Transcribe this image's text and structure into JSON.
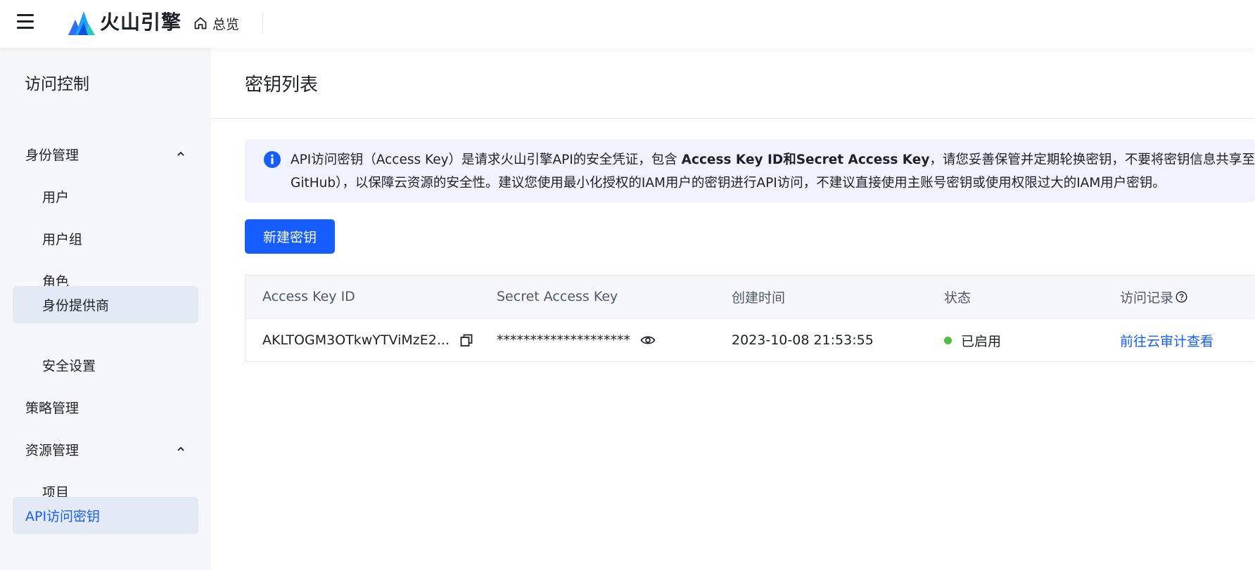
{
  "header": {
    "brand": "火山引擎",
    "home_label": "总览"
  },
  "sidebar": {
    "title": "访问控制",
    "items": [
      {
        "label": "身份管理"
      },
      {
        "label": "用户"
      },
      {
        "label": "用户组"
      },
      {
        "label": "角色"
      },
      {
        "label": "身份提供商"
      },
      {
        "label": "安全设置"
      },
      {
        "label": "策略管理"
      },
      {
        "label": "资源管理"
      },
      {
        "label": "项目"
      },
      {
        "label": "API访问密钥"
      }
    ]
  },
  "main": {
    "title": "密钥列表",
    "alert": {
      "text_part1": "API访问密钥（Access Key）是请求火山引擎API的安全凭证，包含 ",
      "text_bold": "Access Key ID和Secret Access Key",
      "text_part2": "，请您妥善保管并定期轮换密钥，不要将密钥信息共享至",
      "line2": "GitHub），以保障云资源的安全性。建议您使用最小化授权的IAM用户的密钥进行API访问，不建议直接使用主账号密钥或使用权限过大的IAM用户密钥。"
    },
    "new_key_button": "新建密钥",
    "table": {
      "columns": [
        "Access Key ID",
        "Secret Access Key",
        "创建时间",
        "状态",
        "访问记录"
      ],
      "rows": [
        {
          "access_key_id": "AKLTOGM3OTkwYTViMzE2...",
          "secret": "********************",
          "created": "2023-10-08 21:53:55",
          "status": "已启用",
          "record_link": "前往云审计查看"
        }
      ]
    }
  },
  "colors": {
    "primary": "#165dff",
    "status_enabled": "#4bc13f",
    "sidebar_bg": "#f5f7fa",
    "alert_bg": "#eef3fd"
  }
}
